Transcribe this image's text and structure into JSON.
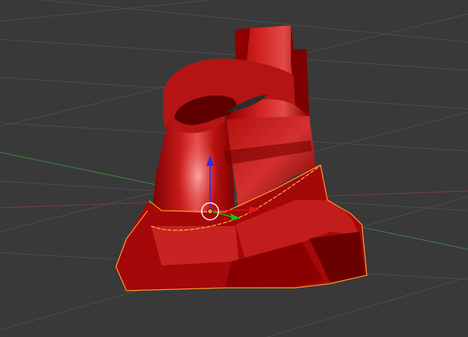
{
  "viewport": {
    "view": "3d-viewport",
    "background_color": "#393939"
  },
  "grid": {
    "line_color": "#4d4d4d",
    "x_axis_color": "#8a3a3a",
    "y_axis_color": "#3f8a3f"
  },
  "mesh": {
    "object_type": "mesh",
    "base_color": "#a50808",
    "dark_color": "#6e0000",
    "highlight_color": "#f07070",
    "selection_edge_color": "#ff9a2a"
  },
  "gizmo": {
    "type": "translate",
    "x_arrow_color": "#e01818",
    "y_arrow_color": "#18c018",
    "z_arrow_color": "#2a2af0",
    "center_color": "#ffffff",
    "origin_color": "#ff9a2a"
  }
}
